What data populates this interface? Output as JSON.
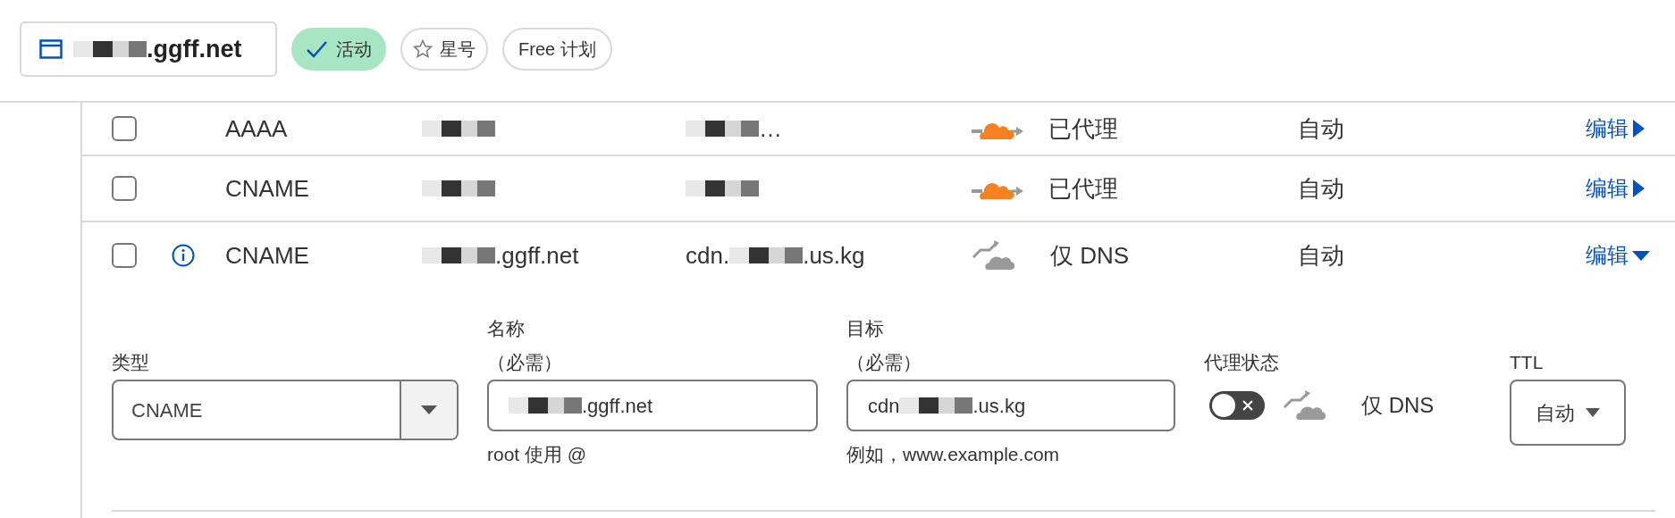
{
  "header": {
    "domain": [
      {
        "kind": "redacted"
      },
      {
        "kind": "text",
        "text": ".ggff.net"
      }
    ],
    "status_badge": {
      "label": "活动"
    },
    "star_button": {
      "label": "星号"
    },
    "plan_badge": {
      "label": "Free 计划"
    }
  },
  "records": [
    {
      "type": "AAAA",
      "checked": false,
      "info": false,
      "name": [
        {
          "kind": "redacted"
        }
      ],
      "content": [
        {
          "kind": "redacted"
        },
        {
          "kind": "text",
          "text": "…"
        }
      ],
      "proxied": true,
      "proxy_status": "已代理",
      "ttl": "自动",
      "edit": "编辑",
      "expanded": false
    },
    {
      "type": "CNAME",
      "checked": false,
      "info": false,
      "name": [
        {
          "kind": "redacted"
        }
      ],
      "content": [
        {
          "kind": "redacted"
        }
      ],
      "proxied": true,
      "proxy_status": "已代理",
      "ttl": "自动",
      "edit": "编辑",
      "expanded": false
    },
    {
      "type": "CNAME",
      "checked": false,
      "info": true,
      "name": [
        {
          "kind": "redacted"
        },
        {
          "kind": "text",
          "text": ".ggff.net"
        }
      ],
      "content": [
        {
          "kind": "text",
          "text": "cdn."
        },
        {
          "kind": "redacted"
        },
        {
          "kind": "text",
          "text": ".us.kg"
        }
      ],
      "proxied": false,
      "proxy_status": "仅 DNS",
      "ttl": "自动",
      "edit": "编辑",
      "expanded": true
    }
  ],
  "edit_form": {
    "type": {
      "label": "类型",
      "value": "CNAME"
    },
    "name": {
      "label": "名称",
      "required": "（必需）",
      "value": [
        {
          "kind": "redacted"
        },
        {
          "kind": "text",
          "text": ".ggff.net"
        }
      ],
      "hint": "root 使用 @"
    },
    "target": {
      "label": "目标",
      "required": "（必需）",
      "value": [
        {
          "kind": "text",
          "text": "cdn"
        },
        {
          "kind": "redacted"
        },
        {
          "kind": "text",
          "text": ".us.kg"
        }
      ],
      "hint": "例如，www.example.com"
    },
    "proxy": {
      "label": "代理状态",
      "on": false,
      "status": "仅 DNS"
    },
    "ttl": {
      "label": "TTL",
      "value": "自动"
    }
  }
}
